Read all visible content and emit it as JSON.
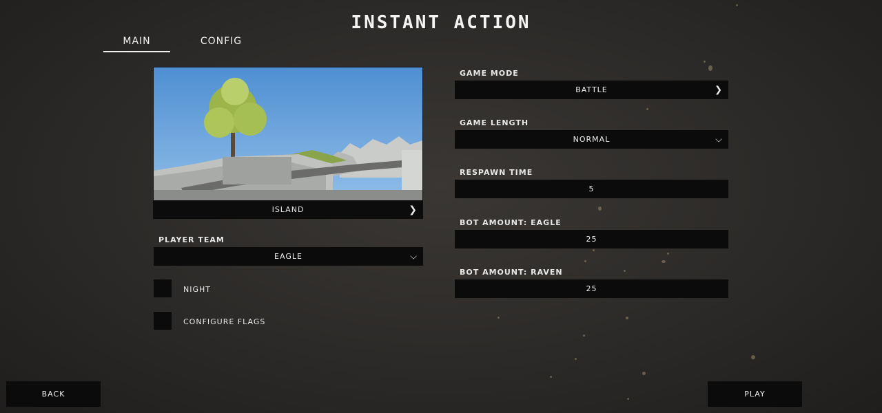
{
  "title": "INSTANT ACTION",
  "tabs": [
    {
      "label": "MAIN",
      "active": true
    },
    {
      "label": "CONFIG",
      "active": false
    }
  ],
  "map": {
    "name": "ISLAND",
    "next_icon": "chevron-right-icon"
  },
  "player_team": {
    "label": "PLAYER TEAM",
    "value": "EAGLE",
    "icon": "chevron-down-icon"
  },
  "options": [
    {
      "label": "NIGHT",
      "checked": false
    },
    {
      "label": "CONFIGURE FLAGS",
      "checked": false
    }
  ],
  "settings": {
    "game_mode": {
      "label": "GAME MODE",
      "value": "BATTLE",
      "icon": "chevron-right-icon"
    },
    "game_length": {
      "label": "GAME LENGTH",
      "value": "NORMAL",
      "icon": "chevron-down-icon"
    },
    "respawn_time": {
      "label": "RESPAWN TIME",
      "value": "5"
    },
    "bot_eagle": {
      "label": "BOT AMOUNT: EAGLE",
      "value": "25"
    },
    "bot_raven": {
      "label": "BOT AMOUNT: RAVEN",
      "value": "25"
    }
  },
  "buttons": {
    "back": "BACK",
    "play": "PLAY"
  },
  "colors": {
    "background": "#2c2a28",
    "field": "#0b0b0b",
    "text": "#f0f0f0",
    "sky": "#5b9ad6"
  }
}
